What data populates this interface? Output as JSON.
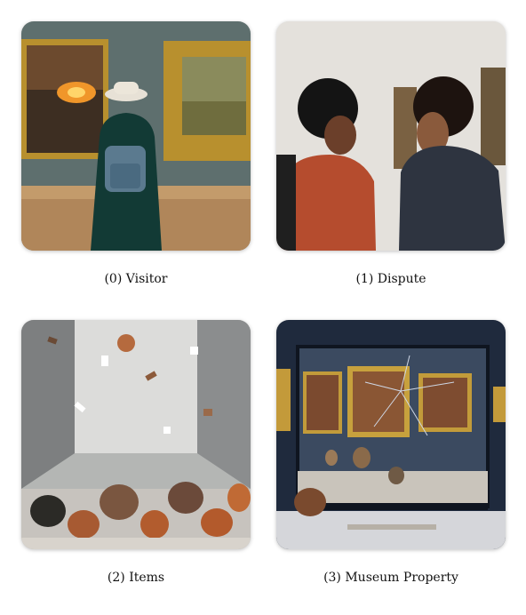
{
  "panels": [
    {
      "caption": "(0) Visitor"
    },
    {
      "caption": "(1) Dispute"
    },
    {
      "caption": "(2) Items"
    },
    {
      "caption": "(3) Museum Property"
    }
  ]
}
